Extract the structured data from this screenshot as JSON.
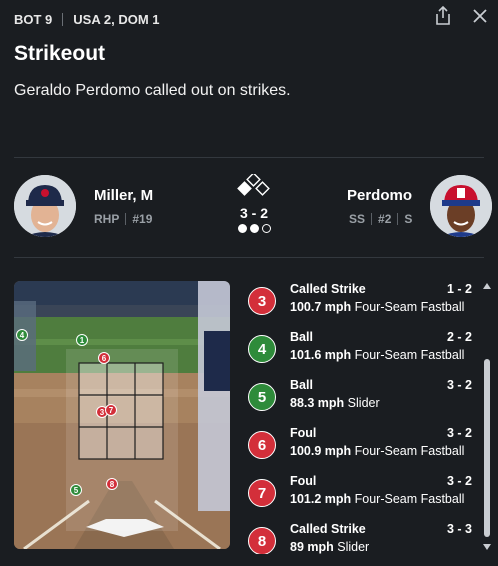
{
  "header": {
    "inning": "BOT 9",
    "score": "USA 2, DOM 1"
  },
  "play": {
    "title": "Strikeout",
    "description": "Geraldo Perdomo called out on strikes."
  },
  "pitcher": {
    "name": "Miller, M",
    "throws": "RHP",
    "number": "#19"
  },
  "batter": {
    "name": "Perdomo",
    "position": "SS",
    "number": "#2",
    "bats": "S"
  },
  "situation": {
    "count": "3 - 2",
    "outs": 2,
    "outs_max": 3,
    "bases_occupied": []
  },
  "colors": {
    "strike": "#d32f3a",
    "ball": "#2e8b3a",
    "background": "#1a1d21"
  },
  "field_markers": [
    {
      "label": "1",
      "type": "ball"
    },
    {
      "label": "4",
      "type": "ball"
    },
    {
      "label": "5",
      "type": "ball"
    },
    {
      "label": "6",
      "type": "strike"
    },
    {
      "label": "8",
      "type": "strike"
    },
    {
      "label": "3",
      "type": "strike"
    },
    {
      "label": "7",
      "type": "strike"
    }
  ],
  "pitches": [
    {
      "num": "3",
      "result": "Called Strike",
      "count": "1 - 2",
      "speed": "100.7 mph",
      "pitch_type": "Four-Seam Fastball",
      "type": "strike"
    },
    {
      "num": "4",
      "result": "Ball",
      "count": "2 - 2",
      "speed": "101.6 mph",
      "pitch_type": "Four-Seam Fastball",
      "type": "ball"
    },
    {
      "num": "5",
      "result": "Ball",
      "count": "3 - 2",
      "speed": "88.3 mph",
      "pitch_type": "Slider",
      "type": "ball"
    },
    {
      "num": "6",
      "result": "Foul",
      "count": "3 - 2",
      "speed": "100.9 mph",
      "pitch_type": "Four-Seam Fastball",
      "type": "strike"
    },
    {
      "num": "7",
      "result": "Foul",
      "count": "3 - 2",
      "speed": "101.2 mph",
      "pitch_type": "Four-Seam Fastball",
      "type": "strike"
    },
    {
      "num": "8",
      "result": "Called Strike",
      "count": "3 - 3",
      "speed": "89 mph",
      "pitch_type": "Slider",
      "type": "strike"
    }
  ]
}
